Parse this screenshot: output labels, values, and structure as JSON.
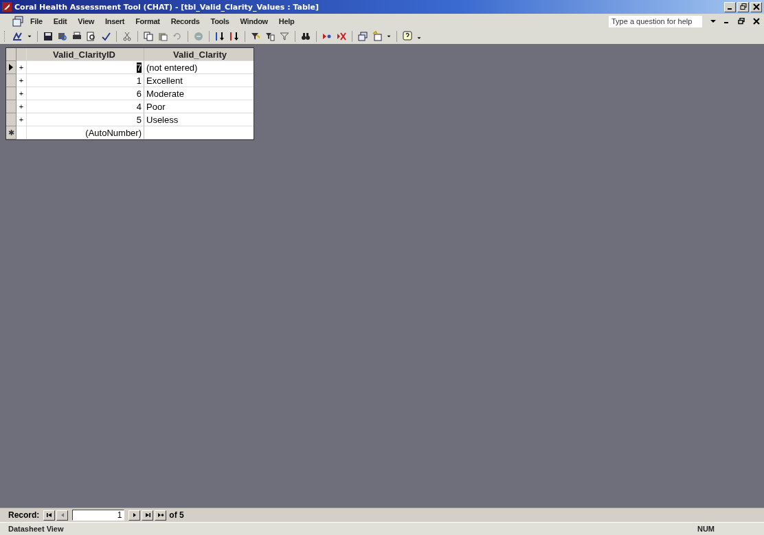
{
  "window": {
    "title": "Coral Health Assessment Tool (CHAT) - [tbl_Valid_Clarity_Values : Table]"
  },
  "menu": [
    "File",
    "Edit",
    "View",
    "Insert",
    "Format",
    "Records",
    "Tools",
    "Window",
    "Help"
  ],
  "help_box": {
    "placeholder": "Type a question for help"
  },
  "table": {
    "columns": [
      "Valid_ClarityID",
      "Valid_Clarity"
    ],
    "rows": [
      {
        "expander": "+",
        "id": "7",
        "clarity": "(not entered)",
        "selected": true
      },
      {
        "expander": "+",
        "id": "1",
        "clarity": "Excellent",
        "selected": false
      },
      {
        "expander": "+",
        "id": "6",
        "clarity": "Moderate",
        "selected": false
      },
      {
        "expander": "+",
        "id": "4",
        "clarity": "Poor",
        "selected": false
      },
      {
        "expander": "+",
        "id": "5",
        "clarity": "Useless",
        "selected": false
      }
    ],
    "new_row": {
      "marker": "✱",
      "id": "(AutoNumber)"
    }
  },
  "record_nav": {
    "label": "Record:",
    "value": "1",
    "total": "of 5"
  },
  "status_bar": {
    "view": "Datasheet View",
    "num": "NUM"
  }
}
